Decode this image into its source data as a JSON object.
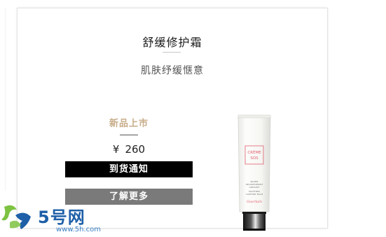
{
  "product": {
    "title": "舒缓修护霜",
    "subtitle": "肌肤纾缓惬意",
    "badge": "新品上市",
    "currency": "¥",
    "price": "260",
    "notify_label": "到货通知",
    "more_label": "了解更多"
  },
  "tube": {
    "brand_line1": "CRÈME",
    "brand_line2": "SOS",
    "desc_lines": [
      "BAUME",
      "RECONFORTANT",
      "APAISANT",
      "SOOTHING",
      "COMFORT BALM"
    ],
    "signature": "Guerlain"
  },
  "watermark": {
    "brand": "5号网",
    "url": "www.5h.com"
  },
  "colors": {
    "badge": "#c8ad8a",
    "notify_button": "#000000",
    "more_button": "#7a7a7a",
    "tube_logo": "#e06070",
    "watermark_blue": "#1e5fa8",
    "watermark_green": "#7dc242"
  }
}
